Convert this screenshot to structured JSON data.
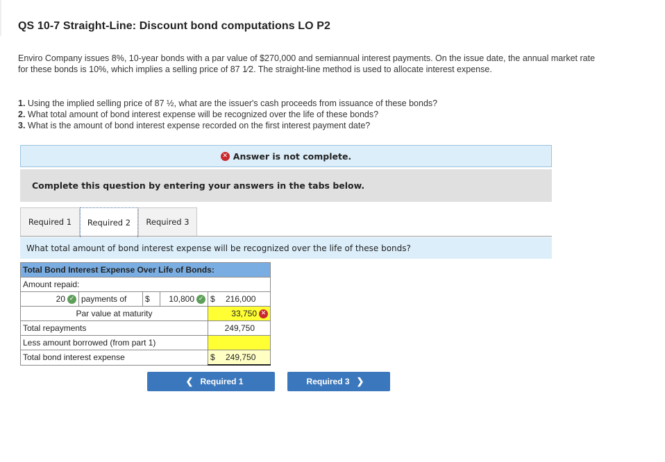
{
  "header": {
    "title": "QS 10-7 Straight-Line: Discount bond computations LO P2"
  },
  "problem": {
    "intro": "Enviro Company issues 8%, 10-year bonds with a par value of $270,000 and semiannual interest payments. On the issue date, the annual market rate for these bonds is 10%, which implies a selling price of 87 1⁄2. The straight-line method is used to allocate interest expense.",
    "questions": [
      {
        "num": "1.",
        "text": " Using the implied selling price of 87 ½, what are the issuer's cash proceeds from issuance of these bonds?"
      },
      {
        "num": "2.",
        "text": " What total amount of bond interest expense will be recognized over the life of these bonds?"
      },
      {
        "num": "3.",
        "text": " What is the amount of bond interest expense recorded on the first interest payment date?"
      }
    ]
  },
  "alert": {
    "icon": "x-circle-icon",
    "text": "Answer is not complete."
  },
  "instructions": "Complete this question by entering your answers in the tabs below.",
  "tabs": [
    {
      "label": "Required 1",
      "active": false
    },
    {
      "label": "Required 2",
      "active": true
    },
    {
      "label": "Required 3",
      "active": false
    }
  ],
  "active_question": "What total amount of bond interest expense will be recognized over the life of these bonds?",
  "worksheet": {
    "header": "Total Bond Interest Expense Over Life of Bonds:",
    "amount_repaid_label": "Amount repaid:",
    "payments_count": "20",
    "payments_count_status": "correct",
    "payments_of_label": "payments of",
    "currency": "$",
    "payment_amount": "10,800",
    "payment_amount_status": "correct",
    "payments_total": "216,000",
    "par_value_label": "Par value at maturity",
    "par_value": "33,750",
    "par_value_status": "incorrect",
    "total_repayments_label": "Total repayments",
    "total_repayments": "249,750",
    "less_borrowed_label": "Less amount borrowed (from part 1)",
    "less_borrowed": "",
    "total_expense_label": "Total bond interest expense",
    "total_expense": "249,750"
  },
  "nav": {
    "prev_label": "Required 1",
    "next_label": "Required 3"
  },
  "colors": {
    "accent": "#3b77bc",
    "table_header": "#7aaee3",
    "alert_bg": "#dceefa",
    "correct": "#5ea05a",
    "incorrect": "#c9282d",
    "highlight": "#ffff33"
  }
}
